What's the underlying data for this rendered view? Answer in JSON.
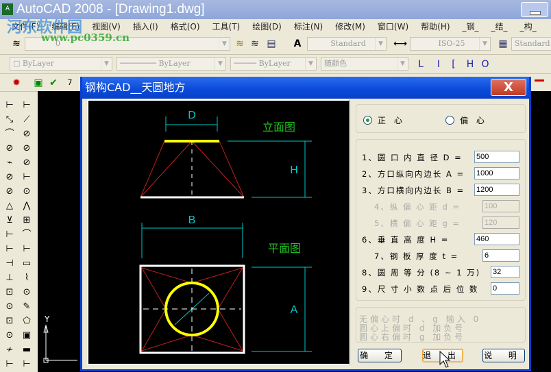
{
  "window": {
    "title": "AutoCAD 2008 - [Drawing1.dwg]",
    "icon": "autocad-icon"
  },
  "watermark": {
    "line1": "河东软件园",
    "line2": "www.pc0359.cn"
  },
  "menu": [
    "文件(F)",
    "编辑(E)",
    "视图(V)",
    "插入(I)",
    "格式(O)",
    "工具(T)",
    "绘图(D)",
    "标注(N)",
    "修改(M)",
    "窗口(W)",
    "帮助(H)",
    "_钢_",
    "_结_",
    "_构_"
  ],
  "toolbar1": {
    "layer": "0",
    "text_style": "Standard",
    "dim_style": "ISO-25",
    "table_style": "Standard"
  },
  "toolbar2": {
    "color": "ByLayer",
    "linetype": "ByLayer",
    "lineweight": "ByLayer",
    "plotstyle": "随颜色",
    "letters": [
      "L",
      "I",
      "[",
      "H",
      "O"
    ]
  },
  "canvas": {
    "ucs_y": "Y"
  },
  "dialog": {
    "title": "钢构CAD__天圆地方",
    "close": "X",
    "drawing": {
      "label_elevation": "立面图",
      "label_plan": "平面图",
      "dim_D": "D",
      "dim_H": "H",
      "dim_B": "B",
      "dim_A": "A"
    },
    "mode": {
      "options": [
        "正 心",
        "偏 心"
      ],
      "selected": 0
    },
    "fields": [
      {
        "label": "1、圆 口 内 直 径 D =",
        "value": "500",
        "enabled": true
      },
      {
        "label": "2、方口纵向内边长 A =",
        "value": "1000",
        "enabled": true
      },
      {
        "label": "3、方口横向内边长 B =",
        "value": "1200",
        "enabled": true
      },
      {
        "label": "4、纵 偏 心 距 d =",
        "value": "100",
        "enabled": false
      },
      {
        "label": "5、横 偏 心 距 g =",
        "value": "120",
        "enabled": false
      },
      {
        "label": "6、垂 直 高 度 H =",
        "value": "460",
        "enabled": true
      },
      {
        "label": "7、钢 板 厚 度 t =",
        "value": "6",
        "enabled": true
      },
      {
        "label": "8、圆 周 等 分 (8 ~ 1 万)",
        "value": "32",
        "enabled": true
      },
      {
        "label": "9、尺 寸 小 数 点 后 位 数",
        "value": "0",
        "enabled": true
      }
    ],
    "notes": [
      "无偏心时 d 、g 输入 0",
      "圆心上偏时  d 加负号",
      "  圆心右偏时  g 加负号"
    ],
    "buttons": {
      "ok": "确 定",
      "exit": "退 出",
      "help": "说 明"
    }
  },
  "colors": {
    "title_blue": "#0a4ad8",
    "cad_yellow": "#ffff00",
    "cad_cyan": "#00c8c8",
    "cad_red": "#c02020",
    "cad_green": "#20c020"
  }
}
